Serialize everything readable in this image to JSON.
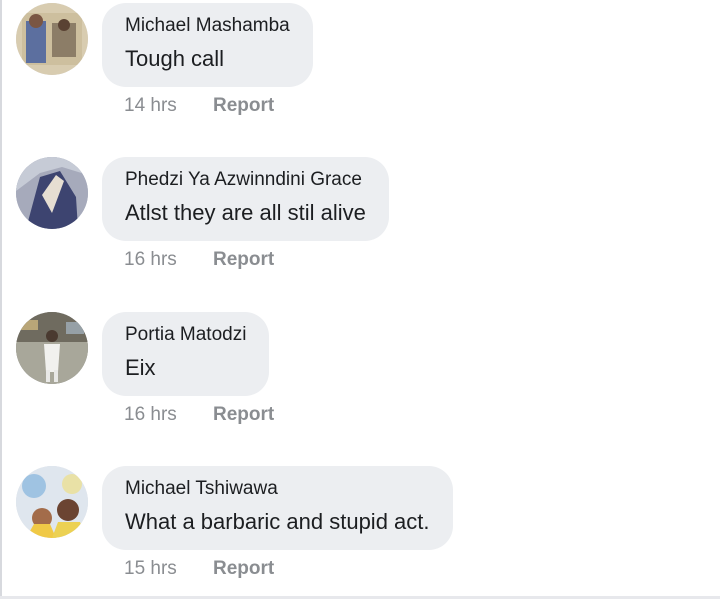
{
  "comments": [
    {
      "author": "Phedzi Ya Azwinndini Grace",
      "text": "Atlst they are all stil alive",
      "time": "16 hrs",
      "action": "Report"
    },
    {
      "author": "Portia Matodzi",
      "text": "Eix",
      "time": "16 hrs",
      "action": "Report"
    },
    {
      "author": "Michael Tshiwawa",
      "text": "What a barbaric and stupid act.",
      "time": "15 hrs",
      "action": "Report"
    },
    {
      "author": "Michael Mashamba",
      "text": "Tough call",
      "time": "14 hrs",
      "action": "Report"
    }
  ],
  "colors": {
    "bubble": "#eceef1",
    "text": "#1c1e21",
    "muted": "#8a8d91"
  }
}
